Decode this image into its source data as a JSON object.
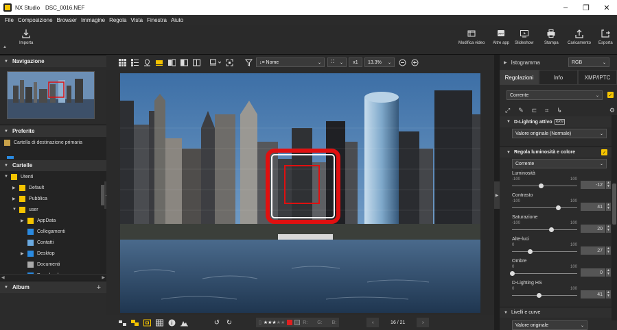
{
  "titlebar": {
    "app_name": "NX Studio",
    "file_name": "DSC_0016.NEF",
    "minimize": "–",
    "maximize": "❐",
    "close": "✕"
  },
  "menu": [
    "File",
    "Composizione",
    "Browser",
    "Immagine",
    "Regola",
    "Vista",
    "Finestra",
    "Aiuto"
  ],
  "toolbar": {
    "import": "Importa",
    "edit_video": "Modifica video",
    "other_apps": "Altre app",
    "slideshow": "Slideshow",
    "print": "Stampa",
    "upload": "Caricamento",
    "export": "Esporta"
  },
  "left": {
    "navigation": "Navigazione",
    "favorites": "Preferite",
    "favorite_item": "Cartella di destinazione primaria",
    "folders": "Cartelle",
    "tree": [
      {
        "label": "Utenti",
        "level": 0,
        "expanded": true
      },
      {
        "label": "Default",
        "level": 1,
        "expanded": false
      },
      {
        "label": "Pubblica",
        "level": 1,
        "expanded": false
      },
      {
        "label": "user",
        "level": 1,
        "expanded": true
      },
      {
        "label": "AppData",
        "level": 2,
        "expanded": false
      },
      {
        "label": "Collegamenti",
        "level": 2,
        "expanded": false
      },
      {
        "label": "Contatti",
        "level": 2,
        "expanded": false
      },
      {
        "label": "Desktop",
        "level": 2,
        "expanded": false
      },
      {
        "label": "Documenti",
        "level": 2,
        "expanded": false
      },
      {
        "label": "Download",
        "level": 2,
        "expanded": false
      }
    ],
    "album": "Album",
    "album_add": "+"
  },
  "center": {
    "sort_label": "Nome",
    "zoom_mult": "x1",
    "zoom_pct": "13.3%",
    "page_counter": "16 / 21",
    "rgb_labels": {
      "r": "R:",
      "g": "G:",
      "b": "B:"
    }
  },
  "right": {
    "histogram": "Istogramma",
    "histogram_channel": "RGB",
    "tabs": [
      "Regolazioni",
      "Info",
      "XMP/IPTC"
    ],
    "preset": "Corrente",
    "dlighting_title": "D-Lighting attivo",
    "raw_badge": "RAW",
    "dlighting_value": "Valore originale (Normale)",
    "brightness_title": "Regola luminosità e colore",
    "brightness_preset": "Corrente",
    "sliders": [
      {
        "name": "Luminosità",
        "min": "-100",
        "max": "100",
        "value": "-12",
        "fraction": 0.44
      },
      {
        "name": "Contrasto",
        "min": "-100",
        "max": "100",
        "value": "41",
        "fraction": 0.7
      },
      {
        "name": "Saturazione",
        "min": "-100",
        "max": "100",
        "value": "20",
        "fraction": 0.6
      },
      {
        "name": "Alte-luci",
        "min": "0",
        "max": "100",
        "value": "27",
        "fraction": 0.27
      },
      {
        "name": "Ombre",
        "min": "0",
        "max": "100",
        "value": "0",
        "fraction": 0.0
      },
      {
        "name": "D-Lighting HS",
        "min": "0",
        "max": "100",
        "value": "41",
        "fraction": 0.41
      }
    ],
    "levels_title": "Livelli e curve",
    "levels_value": "Valore originale"
  },
  "colors": {
    "accent": "#f5c400",
    "highlight_red": "#e01010",
    "panel_bg": "#2b2b2b"
  }
}
